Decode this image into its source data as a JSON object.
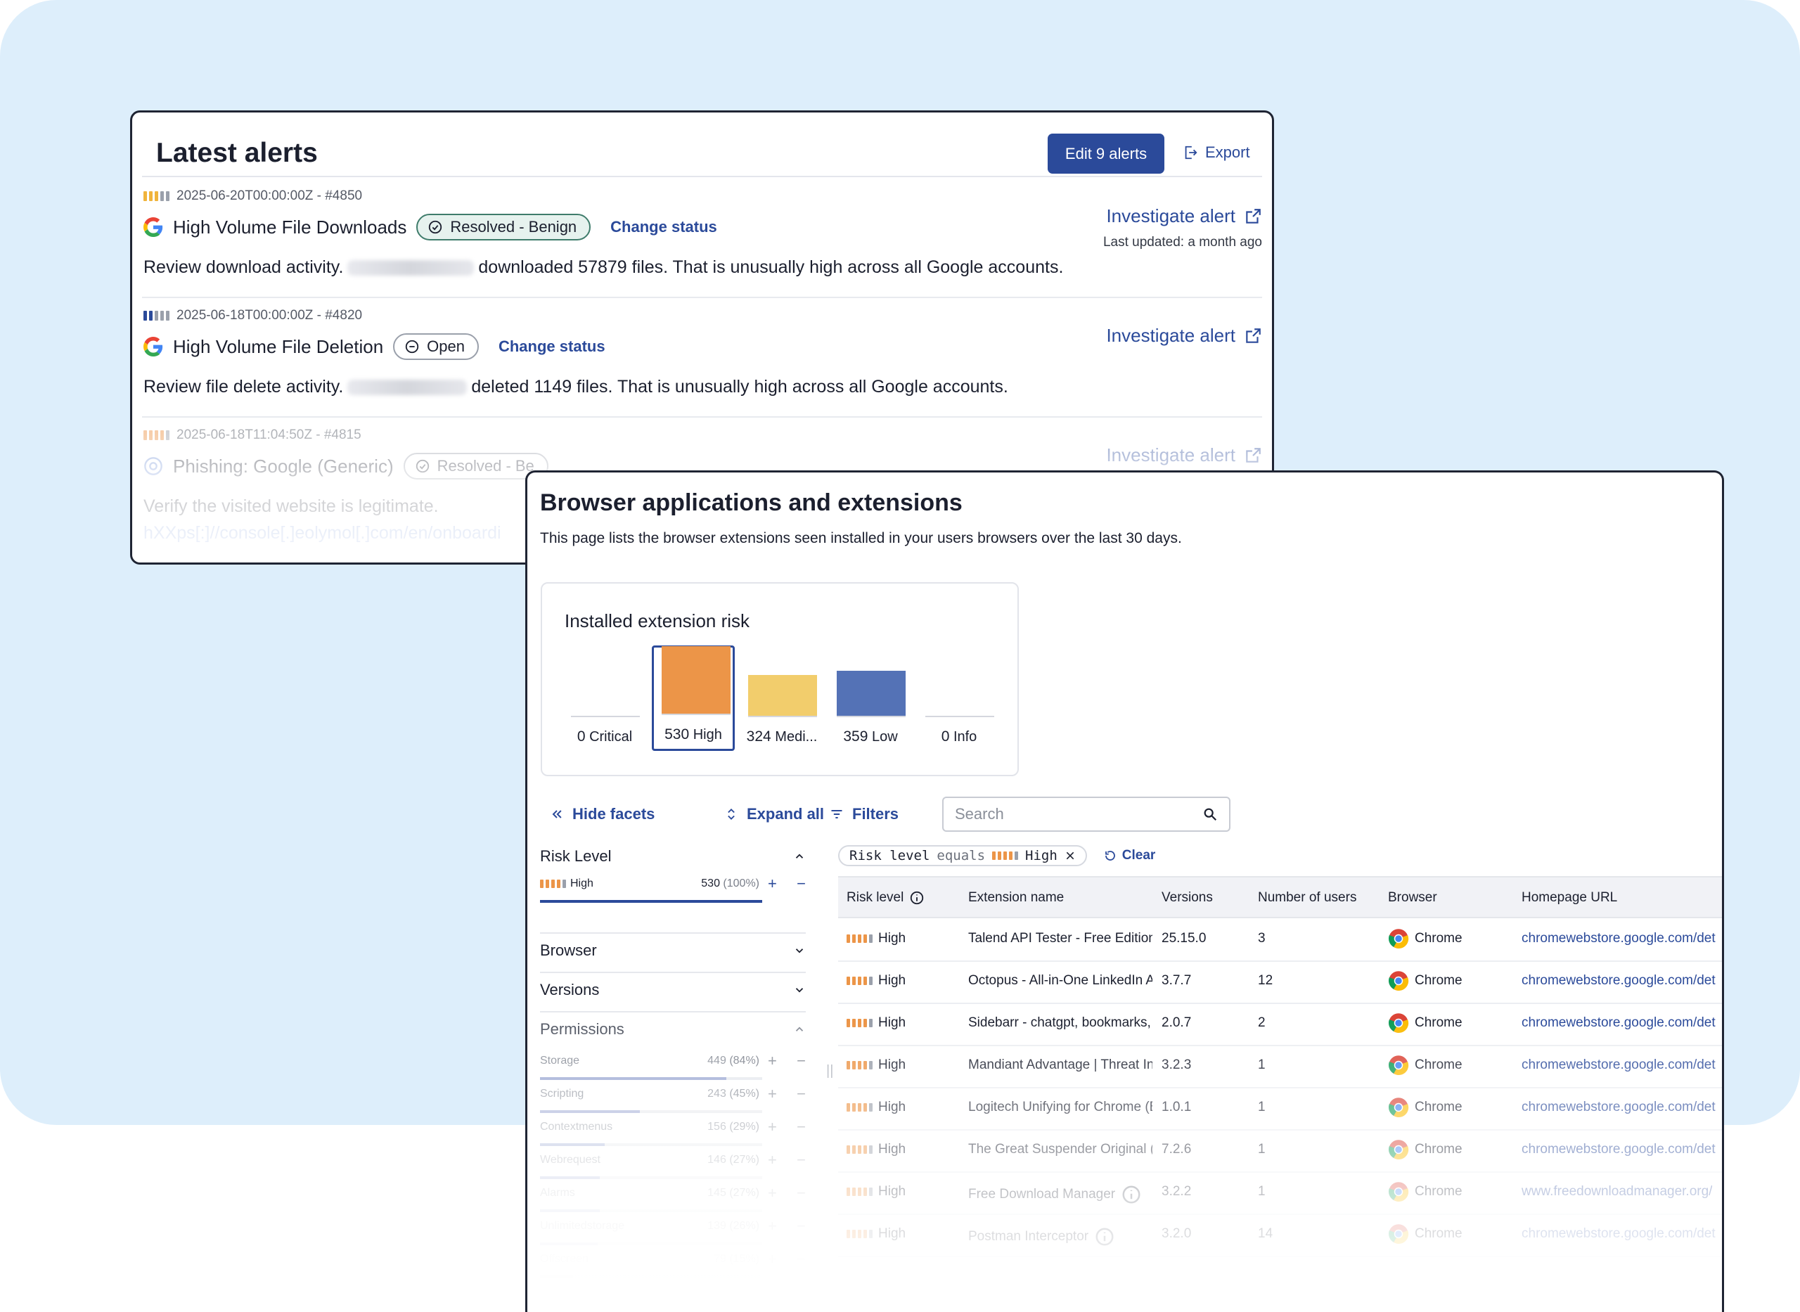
{
  "colors": {
    "accent": "#2b4a9a",
    "high": "#ec9548",
    "medium": "#f2cd6c",
    "low": "#5472b6",
    "background": "#ddeefb"
  },
  "alerts": {
    "title": "Latest alerts",
    "edit_label": "Edit 9 alerts",
    "export_label": "Export",
    "items": [
      {
        "meta": "2025-06-20T00:00:00Z - #4850",
        "name": "High Volume File Downloads",
        "status": "Resolved - Benign",
        "change_status": "Change status",
        "desc_before": "Review download activity.",
        "desc_after": "downloaded 57879 files. That is unusually high across all Google accounts.",
        "investigate": "Investigate alert",
        "updated": "Last updated: a month ago"
      },
      {
        "meta": "2025-06-18T00:00:00Z - #4820",
        "name": "High Volume File Deletion",
        "status": "Open",
        "change_status": "Change status",
        "desc_before": "Review file delete activity.",
        "desc_after": "deleted 1149 files. That is unusually high across all Google accounts.",
        "investigate": "Investigate alert"
      },
      {
        "meta": "2025-06-18T11:04:50Z - #4815",
        "name": "Phishing: Google (Generic)",
        "status": "Resolved - Be",
        "desc": "Verify the visited website is legitimate.",
        "desc2": "hXXps[:]//console[.]eolymol[.]com/en/onboardi",
        "investigate": "Investigate alert"
      }
    ]
  },
  "browser": {
    "title": "Browser applications and extensions",
    "subtitle": "This page lists the browser extensions seen installed in your users browsers over the last 30 days.",
    "risk": {
      "title": "Installed extension risk",
      "bars": [
        {
          "count": "0",
          "label": "Critical",
          "value": 0
        },
        {
          "count": "530",
          "label": "High",
          "value": 530
        },
        {
          "count": "324",
          "label": "Medi...",
          "value": 324
        },
        {
          "count": "359",
          "label": "Low",
          "value": 359
        },
        {
          "count": "0",
          "label": "Info",
          "value": 0
        }
      ]
    },
    "tools": {
      "hide_facets": "Hide facets",
      "expand_all": "Expand all",
      "filters": "Filters",
      "search_placeholder": "Search"
    },
    "facets": {
      "risk_level": "Risk Level",
      "risk_row": {
        "name": "High",
        "count": "530",
        "pct": "(100%)",
        "fraction": 1.0
      },
      "browser": "Browser",
      "versions": "Versions",
      "permissions": "Permissions",
      "permission_rows": [
        {
          "name": "Storage",
          "count": "449",
          "pct": "(84%)",
          "fraction": 0.84
        },
        {
          "name": "Scripting",
          "count": "243",
          "pct": "(45%)",
          "fraction": 0.45
        },
        {
          "name": "Contextmenus",
          "count": "156",
          "pct": "(29%)",
          "fraction": 0.29
        },
        {
          "name": "Webrequest",
          "count": "146",
          "pct": "(27%)",
          "fraction": 0.27
        },
        {
          "name": "Alarms",
          "count": "145",
          "pct": "(27%)",
          "fraction": 0.27
        },
        {
          "name": "Unlimitedstorage",
          "count": "139",
          "pct": "(26%)",
          "fraction": 0.26
        },
        {
          "name": "Offscreen",
          "count": "79",
          "pct": "(15%)",
          "fraction": 0.15
        }
      ]
    },
    "filter_chip": {
      "field": "Risk level",
      "op": "equals",
      "value": "High"
    },
    "clear_label": "Clear",
    "table": {
      "headers": [
        "Risk level",
        "Extension name",
        "Versions",
        "Number of users",
        "Browser",
        "Homepage URL"
      ],
      "rows": [
        {
          "risk": "High",
          "name": "Talend API Tester - Free Edition",
          "version": "25.15.0",
          "users": "3",
          "browser": "Chrome",
          "url": "chromewebstore.google.com/det"
        },
        {
          "risk": "High",
          "name": "Octopus - All-in-One LinkedIn Automation",
          "version": "3.7.7",
          "users": "12",
          "browser": "Chrome",
          "url": "chromewebstore.google.com/det"
        },
        {
          "risk": "High",
          "name": "Sidebarr - chatgpt, bookmarks, apps",
          "version": "2.0.7",
          "users": "2",
          "browser": "Chrome",
          "url": "chromewebstore.google.com/det"
        },
        {
          "risk": "High",
          "name": "Mandiant Advantage | Threat Intelligence",
          "version": "3.2.3",
          "users": "1",
          "browser": "Chrome",
          "url": "chromewebstore.google.com/det"
        },
        {
          "risk": "High",
          "name": "Logitech Unifying for Chrome (Beta)",
          "version": "1.0.1",
          "users": "1",
          "browser": "Chrome",
          "url": "chromewebstore.google.com/det"
        },
        {
          "risk": "High",
          "name": "The Great Suspender Original (Fixed)",
          "version": "7.2.6",
          "users": "1",
          "browser": "Chrome",
          "url": "chromewebstore.google.com/det"
        },
        {
          "risk": "High",
          "name": "Free Download Manager",
          "version": "3.2.2",
          "users": "1",
          "browser": "Chrome",
          "url": "www.freedownloadmanager.org/"
        },
        {
          "risk": "High",
          "name": "Postman Interceptor",
          "version": "3.2.0",
          "users": "14",
          "browser": "Chrome",
          "url": "chromewebstore.google.com/det"
        }
      ]
    }
  }
}
